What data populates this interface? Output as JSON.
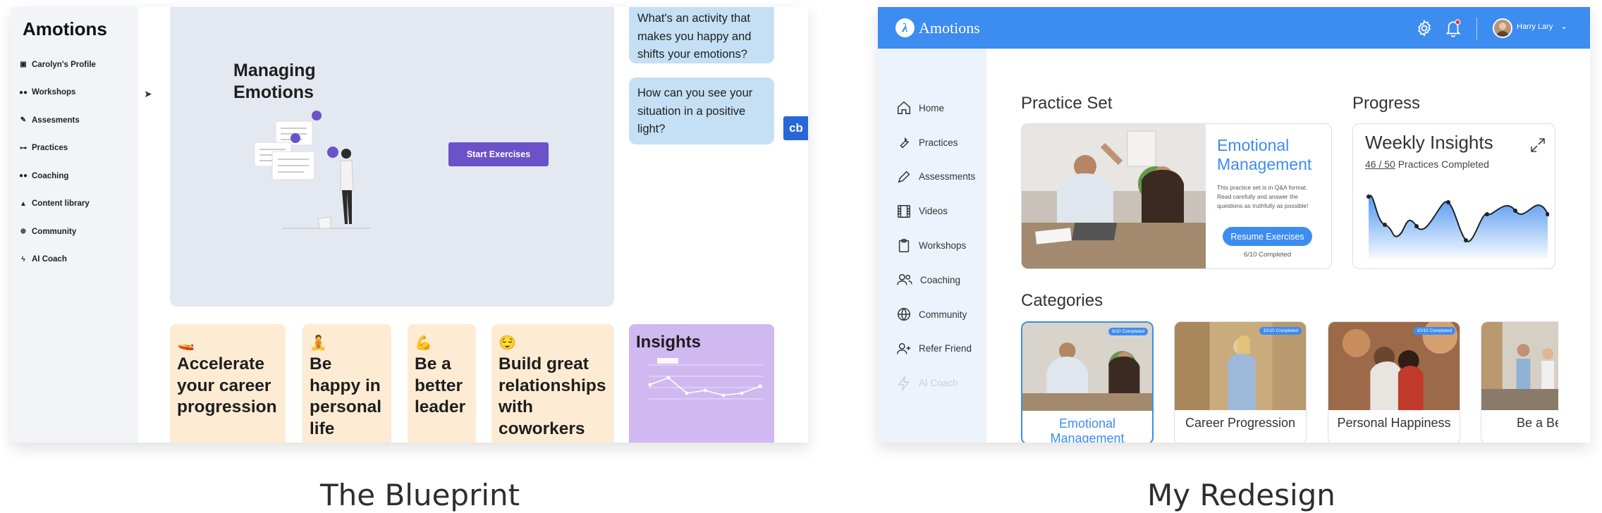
{
  "captions": {
    "left": "The Blueprint",
    "right": "My Redesign"
  },
  "blueprint": {
    "logo": "Amotions",
    "nav": [
      {
        "label": "Carolyn's Profile",
        "icon": "profile-icon"
      },
      {
        "label": "Workshops",
        "icon": "people-icon"
      },
      {
        "label": "Assesments",
        "icon": "pencil-icon"
      },
      {
        "label": "Practices",
        "icon": "dumbbell-icon"
      },
      {
        "label": "Coaching",
        "icon": "users-icon"
      },
      {
        "label": "Content library",
        "icon": "grad-cap-icon"
      },
      {
        "label": "Community",
        "icon": "globe-icon"
      },
      {
        "label": "AI Coach",
        "icon": "bolt-icon"
      }
    ],
    "hero": {
      "title_line1": "Managing",
      "title_line2": "Emotions",
      "button": "Start Exercises"
    },
    "bubbles": [
      "What's an activity that makes you happy and shifts your emotions?",
      "How can you see your situation in a positive light?"
    ],
    "cb_badge": "cb",
    "cards": [
      {
        "emoji": "🚤",
        "text": "Accelerate your career progression"
      },
      {
        "emoji": "🧘",
        "text": "Be happy in personal life"
      },
      {
        "emoji": "💪",
        "text": "Be a better leader"
      },
      {
        "emoji": "😌",
        "text": "Build great relationships with coworkers"
      }
    ],
    "insights": {
      "title": "Insights"
    }
  },
  "redesign": {
    "logo": "Amotions",
    "user_name": "Harry Lary",
    "nav": [
      {
        "label": "Home",
        "icon": "home-icon",
        "disabled": false
      },
      {
        "label": "Practices",
        "icon": "wrench-icon",
        "disabled": false
      },
      {
        "label": "Assessments",
        "icon": "pen-icon",
        "disabled": false
      },
      {
        "label": "Videos",
        "icon": "film-icon",
        "disabled": false
      },
      {
        "label": "Workshops",
        "icon": "clipboard-icon",
        "disabled": false
      },
      {
        "label": "Coaching",
        "icon": "users-icon",
        "disabled": false
      },
      {
        "label": "Community",
        "icon": "globe-icon",
        "disabled": false
      },
      {
        "label": "Refer Friend",
        "icon": "user-plus-icon",
        "disabled": false
      },
      {
        "label": "AI Coach",
        "icon": "bolt-icon",
        "disabled": true
      }
    ],
    "practice_set": {
      "heading": "Practice Set",
      "title": "Emotional Management",
      "description": "This practice set is in Q&A format. Read carefully and answer the questions as truthfully as possible!",
      "button": "Resume Exercises",
      "count": "6/10 Completed"
    },
    "progress": {
      "heading": "Progress",
      "title": "Weekly Insights",
      "sub_count": "46 / 50",
      "sub_text": "Practices Completed"
    },
    "categories": {
      "heading": "Categories",
      "items": [
        {
          "name": "Emotional Management",
          "badge": "6/10 Completed",
          "active": true
        },
        {
          "name": "Career Progression",
          "badge": "10/10 Completed",
          "active": false
        },
        {
          "name": "Personal Happiness",
          "badge": "10/10 Completed",
          "active": false
        },
        {
          "name": "Be a Better Leader",
          "badge": "",
          "active": false
        }
      ]
    },
    "colors": {
      "brand": "#3d8cf0",
      "sidebar": "#edf3fc"
    }
  }
}
